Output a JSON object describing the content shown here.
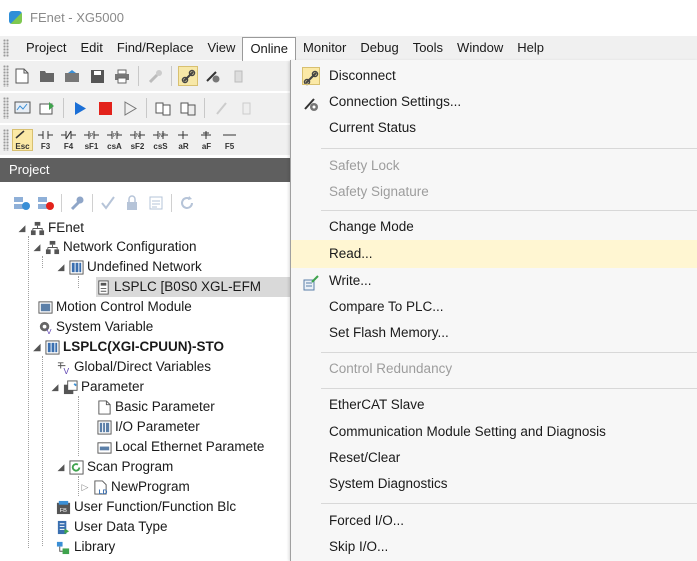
{
  "window": {
    "title": "FEnet - XG5000"
  },
  "menubar": {
    "items": [
      "Project",
      "Edit",
      "Find/Replace",
      "View",
      "Online",
      "Monitor",
      "Debug",
      "Tools",
      "Window",
      "Help"
    ]
  },
  "keybar": {
    "keys": [
      {
        "top": "",
        "bottom": "Esc"
      },
      {
        "top": "",
        "bottom": "F3"
      },
      {
        "top": "",
        "bottom": "F4"
      },
      {
        "top": "",
        "bottom": "sF1"
      },
      {
        "top": "",
        "bottom": "csA"
      },
      {
        "top": "",
        "bottom": "sF2"
      },
      {
        "top": "",
        "bottom": "csS"
      },
      {
        "top": "",
        "bottom": "aR"
      },
      {
        "top": "",
        "bottom": "aF"
      },
      {
        "top": "",
        "bottom": "F5"
      }
    ]
  },
  "project_panel": {
    "title": "Project"
  },
  "tree": {
    "root": "FEnet",
    "network_configuration": "Network Configuration",
    "undefined_network": "Undefined Network",
    "lsplc_node": "LSPLC [B0S0 XGL-EFM",
    "motion_control_module": "Motion Control Module",
    "system_variable": "System Variable",
    "plc": "LSPLC(XGI-CPUUN)-STO",
    "global_direct_variables": "Global/Direct Variables",
    "parameter": "Parameter",
    "basic_parameter": "Basic Parameter",
    "io_parameter": "I/O Parameter",
    "local_ethernet_parameter": "Local Ethernet Paramete",
    "scan_program": "Scan Program",
    "new_program": "NewProgram",
    "user_function_block": "User Function/Function Blc",
    "user_data_type": "User Data Type",
    "library": "Library"
  },
  "online_menu": {
    "disconnect": "Disconnect",
    "connection_settings": "Connection Settings...",
    "current_status": "Current Status",
    "safety_lock": "Safety Lock",
    "safety_signature": "Safety Signature",
    "change_mode": "Change Mode",
    "read": "Read...",
    "write": "Write...",
    "compare_to_plc": "Compare To PLC...",
    "set_flash_memory": "Set Flash Memory...",
    "control_redundancy": "Control Redundancy",
    "ethercat_slave": "EtherCAT Slave",
    "comm_module_setting": "Communication Module Setting and Diagnosis",
    "reset_clear": "Reset/Clear",
    "system_diagnostics": "System Diagnostics",
    "forced_io": "Forced I/O...",
    "skip_io": "Skip I/O..."
  },
  "colors": {
    "hover": "#fff6d2",
    "panel_header": "#5f5f5f",
    "disabled": "#9d9d9d"
  }
}
